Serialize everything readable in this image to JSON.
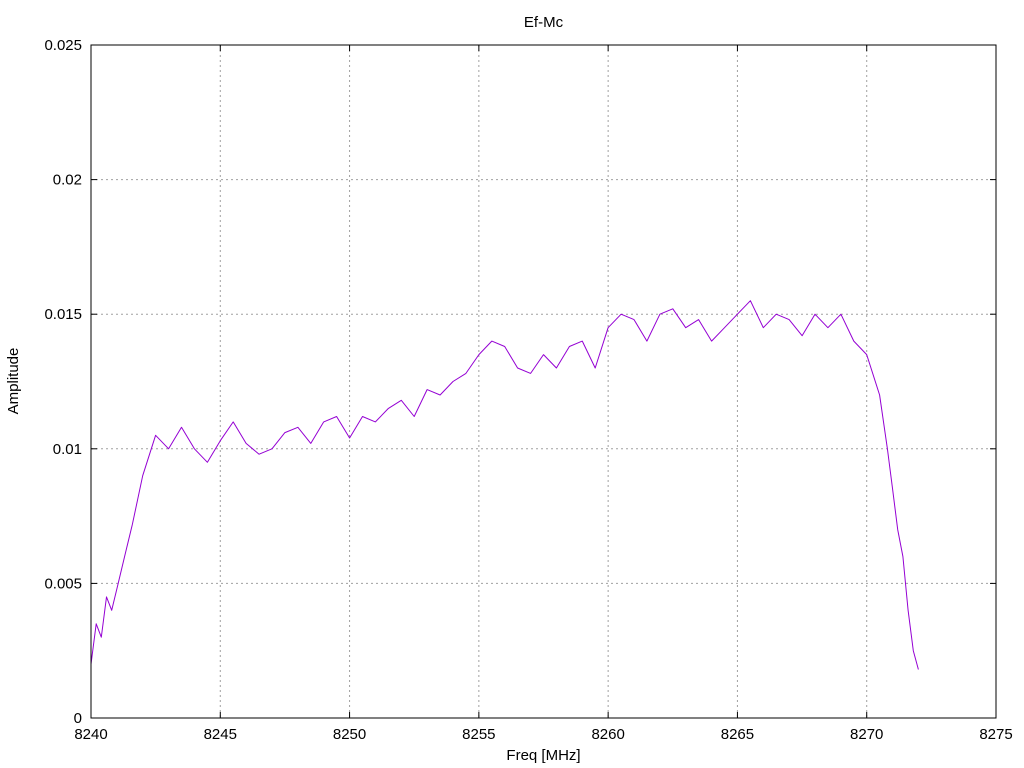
{
  "chart_data": {
    "type": "line",
    "title": "Ef-Mc",
    "xlabel": "Freq [MHz]",
    "ylabel": "Amplitude",
    "xlim": [
      8240,
      8275
    ],
    "ylim": [
      0,
      0.025
    ],
    "x_ticks": [
      8240,
      8245,
      8250,
      8255,
      8260,
      8265,
      8270,
      8275
    ],
    "x_tick_labels": [
      "8240",
      "8245",
      "8250",
      "8255",
      "8260",
      "8265",
      "8270",
      "8275"
    ],
    "y_ticks": [
      0,
      0.005,
      0.01,
      0.015,
      0.02,
      0.025
    ],
    "y_tick_labels": [
      "0",
      "0.005",
      "0.01",
      "0.015",
      "0.02",
      "0.025"
    ],
    "grid": true,
    "series": [
      {
        "name": "",
        "color": "#9400d3",
        "x": [
          8240.0,
          8240.2,
          8240.4,
          8240.6,
          8240.8,
          8241.0,
          8241.3,
          8241.6,
          8242.0,
          8242.5,
          8243.0,
          8243.5,
          8244.0,
          8244.5,
          8245.0,
          8245.5,
          8246.0,
          8246.5,
          8247.0,
          8247.5,
          8248.0,
          8248.5,
          8249.0,
          8249.5,
          8250.0,
          8250.5,
          8251.0,
          8251.5,
          8252.0,
          8252.5,
          8253.0,
          8253.5,
          8254.0,
          8254.5,
          8255.0,
          8255.5,
          8256.0,
          8256.5,
          8257.0,
          8257.5,
          8258.0,
          8258.5,
          8259.0,
          8259.5,
          8260.0,
          8260.5,
          8261.0,
          8261.5,
          8262.0,
          8262.5,
          8263.0,
          8263.5,
          8264.0,
          8264.5,
          8265.0,
          8265.5,
          8266.0,
          8266.5,
          8267.0,
          8267.5,
          8268.0,
          8268.5,
          8269.0,
          8269.5,
          8270.0,
          8270.5,
          8270.8,
          8271.0,
          8271.2,
          8271.4,
          8271.6,
          8271.8,
          8272.0
        ],
        "y": [
          0.002,
          0.0035,
          0.003,
          0.0045,
          0.004,
          0.0048,
          0.006,
          0.0072,
          0.009,
          0.0105,
          0.01,
          0.0108,
          0.01,
          0.0095,
          0.0103,
          0.011,
          0.0102,
          0.0098,
          0.01,
          0.0106,
          0.0108,
          0.0102,
          0.011,
          0.0112,
          0.0104,
          0.0112,
          0.011,
          0.0115,
          0.0118,
          0.0112,
          0.0122,
          0.012,
          0.0125,
          0.0128,
          0.0135,
          0.014,
          0.0138,
          0.013,
          0.0128,
          0.0135,
          0.013,
          0.0138,
          0.014,
          0.013,
          0.0145,
          0.015,
          0.0148,
          0.014,
          0.015,
          0.0152,
          0.0145,
          0.0148,
          0.014,
          0.0145,
          0.015,
          0.0155,
          0.0145,
          0.015,
          0.0148,
          0.0142,
          0.015,
          0.0145,
          0.015,
          0.014,
          0.0135,
          0.012,
          0.01,
          0.0085,
          0.007,
          0.006,
          0.004,
          0.0025,
          0.0018
        ]
      }
    ]
  }
}
